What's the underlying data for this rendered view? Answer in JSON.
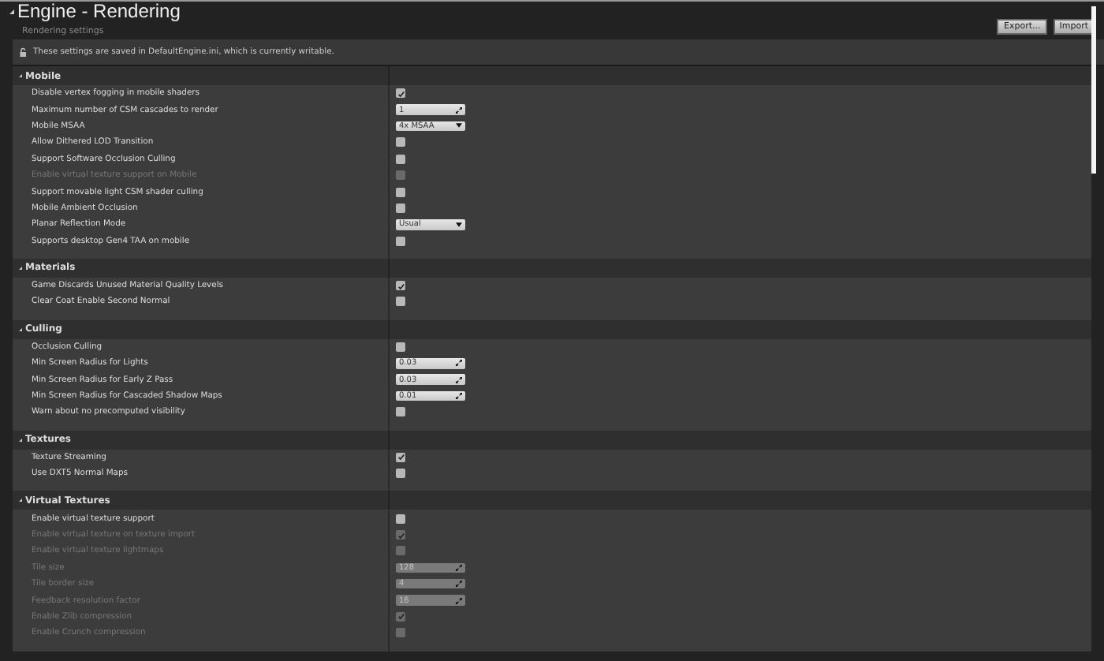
{
  "header": {
    "title": "Engine - Rendering",
    "subtitle": "Rendering settings",
    "buttons": [
      "Export...",
      "Import"
    ]
  },
  "notice": "These settings are saved in DefaultEngine.ini, which is currently writable.",
  "sections": [
    {
      "title": "Mobile",
      "expanded": true,
      "rows": [
        {
          "label": "Disable vertex fogging in mobile shaders",
          "kind": "checkbox",
          "checked": true,
          "disabled": false
        },
        {
          "label": "Maximum number of CSM cascades to render",
          "kind": "number",
          "value": "1",
          "disabled": false
        },
        {
          "label": "Mobile MSAA",
          "kind": "dropdown",
          "value": "4x MSAA",
          "disabled": false
        },
        {
          "label": "Allow Dithered LOD Transition",
          "kind": "checkbox",
          "checked": false,
          "disabled": false
        },
        {
          "label": "Support Software Occlusion Culling",
          "kind": "checkbox",
          "checked": false,
          "disabled": false
        },
        {
          "label": "Enable virtual texture support on Mobile",
          "kind": "checkbox",
          "checked": false,
          "disabled": true
        },
        {
          "label": "Support movable light CSM shader culling",
          "kind": "checkbox",
          "checked": false,
          "disabled": false
        },
        {
          "label": "Mobile Ambient Occlusion",
          "kind": "checkbox",
          "checked": false,
          "disabled": false
        },
        {
          "label": "Planar Reflection Mode",
          "kind": "dropdown",
          "value": "Usual",
          "disabled": false
        },
        {
          "label": "Supports desktop Gen4 TAA on mobile",
          "kind": "checkbox",
          "checked": false,
          "disabled": false
        }
      ]
    },
    {
      "title": "Materials",
      "expanded": true,
      "rows": [
        {
          "label": "Game Discards Unused Material Quality Levels",
          "kind": "checkbox",
          "checked": true,
          "disabled": false
        },
        {
          "label": "Clear Coat Enable Second Normal",
          "kind": "checkbox",
          "checked": false,
          "disabled": false
        }
      ]
    },
    {
      "title": "Culling",
      "expanded": true,
      "rows": [
        {
          "label": "Occlusion Culling",
          "kind": "checkbox",
          "checked": false,
          "disabled": false
        },
        {
          "label": "Min Screen Radius for Lights",
          "kind": "number",
          "value": "0.03",
          "disabled": false
        },
        {
          "label": "Min Screen Radius for Early Z Pass",
          "kind": "number",
          "value": "0.03",
          "disabled": false
        },
        {
          "label": "Min Screen Radius for Cascaded Shadow Maps",
          "kind": "number",
          "value": "0.01",
          "disabled": false
        },
        {
          "label": "Warn about no precomputed visibility",
          "kind": "checkbox",
          "checked": false,
          "disabled": false
        }
      ]
    },
    {
      "title": "Textures",
      "expanded": true,
      "rows": [
        {
          "label": "Texture Streaming",
          "kind": "checkbox",
          "checked": true,
          "disabled": false
        },
        {
          "label": "Use DXT5 Normal Maps",
          "kind": "checkbox",
          "checked": false,
          "disabled": false
        }
      ]
    },
    {
      "title": "Virtual Textures",
      "expanded": true,
      "rows": [
        {
          "label": "Enable virtual texture support",
          "kind": "checkbox",
          "checked": false,
          "disabled": false
        },
        {
          "label": "Enable virtual texture on texture import",
          "kind": "checkbox",
          "checked": true,
          "disabled": true
        },
        {
          "label": "Enable virtual texture lightmaps",
          "kind": "checkbox",
          "checked": false,
          "disabled": true
        },
        {
          "label": "Tile size",
          "kind": "number",
          "value": "128",
          "disabled": true
        },
        {
          "label": "Tile border size",
          "kind": "number",
          "value": "4",
          "disabled": true
        },
        {
          "label": "Feedback resolution factor",
          "kind": "number",
          "value": "16",
          "disabled": true
        },
        {
          "label": "Enable Zlib compression",
          "kind": "checkbox",
          "checked": true,
          "disabled": true
        },
        {
          "label": "Enable Crunch compression",
          "kind": "checkbox",
          "checked": false,
          "disabled": true
        }
      ]
    }
  ]
}
